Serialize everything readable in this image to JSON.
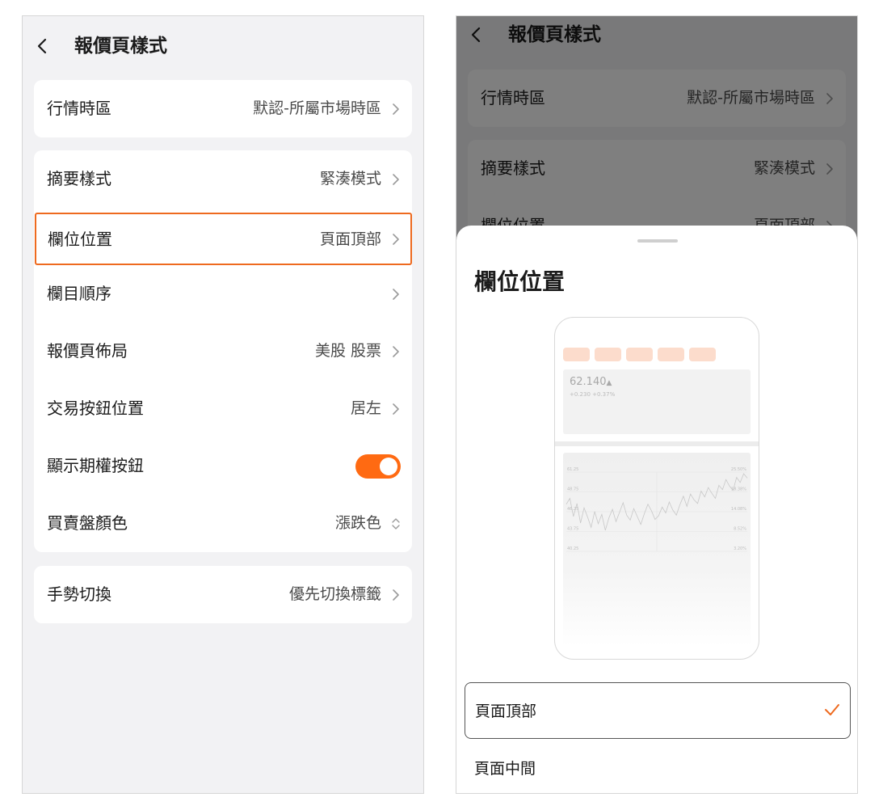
{
  "left": {
    "title": "報價頁樣式",
    "groups": [
      {
        "rows": [
          {
            "label": "行情時區",
            "value": "默認-所屬市場時區"
          }
        ]
      },
      {
        "rows": [
          {
            "label": "摘要樣式",
            "value": "緊湊模式"
          },
          {
            "label": "欄位位置",
            "value": "頁面頂部"
          },
          {
            "label": "欄目順序",
            "value": ""
          },
          {
            "label": "報價頁佈局",
            "value": "美股 股票"
          },
          {
            "label": "交易按鈕位置",
            "value": "居左"
          },
          {
            "label": "顯示期權按鈕",
            "toggle_on": true
          },
          {
            "label": "買賣盤顏色",
            "value": "漲跌色"
          }
        ]
      },
      {
        "rows": [
          {
            "label": "手勢切換",
            "value": "優先切換標籤"
          }
        ]
      }
    ]
  },
  "right": {
    "title": "報價頁樣式",
    "rows": [
      {
        "label": "行情時區",
        "value": "默認-所屬市場時區"
      },
      {
        "label": "摘要樣式",
        "value": "緊湊模式"
      },
      {
        "label": "欄位位置",
        "value": "頁面頂部"
      }
    ],
    "sheet": {
      "title": "欄位位置",
      "preview": {
        "price": "62.140",
        "change": "+0.230 +0.37%",
        "y_left": [
          "61.25",
          "48.75",
          "46.25",
          "43.75",
          "40.25"
        ],
        "y_right": [
          "25.50%",
          "18.38%",
          "14.08%",
          "8.52%",
          "3.20%"
        ],
        "series": [
          46.8,
          47.6,
          45.1,
          46.9,
          44.2,
          46.3,
          45.0,
          43.6,
          45.8,
          44.1,
          45.4,
          43.2,
          44.9,
          46.1,
          44.4,
          45.7,
          47.0,
          45.3,
          44.6,
          46.2,
          45.1,
          44.0,
          45.5,
          46.8,
          45.9,
          44.7,
          45.2,
          46.4,
          45.6,
          47.1,
          46.0,
          45.3,
          46.7,
          47.9,
          46.5,
          48.2,
          47.4,
          46.9,
          48.6,
          47.8,
          49.1,
          48.3,
          47.6,
          49.4,
          48.8,
          50.2,
          49.3,
          48.7,
          50.5,
          49.8,
          51.0,
          50.4
        ]
      },
      "options": [
        {
          "label": "頁面頂部",
          "selected": true
        },
        {
          "label": "頁面中間",
          "selected": false
        }
      ]
    }
  },
  "colors": {
    "accent": "#ff6a12",
    "highlight_border": "#ee6a1f",
    "background": "#f2f2f4"
  },
  "icons": {
    "back": "chevron-left-icon",
    "row": "chevron-right-icon",
    "sort": "sort-updown-icon",
    "check": "check-icon"
  }
}
